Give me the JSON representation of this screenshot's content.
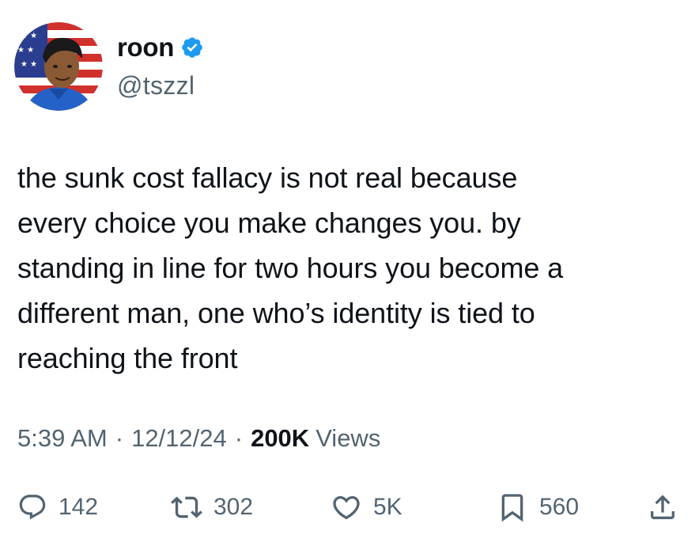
{
  "author": {
    "display_name": "roon",
    "handle": "@tszzl",
    "verified_icon": "verified-badge-icon",
    "avatar_icon": "avatar-image"
  },
  "tweet": {
    "text": "the sunk cost fallacy is not real because\nevery choice you make changes you. by\nstanding in line for two hours you become a\ndifferent man, one who’s identity is tied to\nreaching the front"
  },
  "meta": {
    "time": "5:39 AM",
    "separator": "·",
    "date": "12/12/24",
    "views_count": "200K",
    "views_label": "Views"
  },
  "actions": {
    "reply": {
      "icon": "reply-icon",
      "count": "142"
    },
    "retweet": {
      "icon": "retweet-icon",
      "count": "302"
    },
    "like": {
      "icon": "heart-icon",
      "count": "5K"
    },
    "bookmark": {
      "icon": "bookmark-icon",
      "count": "560"
    },
    "share": {
      "icon": "share-icon"
    }
  },
  "colors": {
    "text_primary": "#0f1419",
    "text_secondary": "#536471",
    "verified_blue": "#1d9bf0",
    "background": "#ffffff"
  }
}
